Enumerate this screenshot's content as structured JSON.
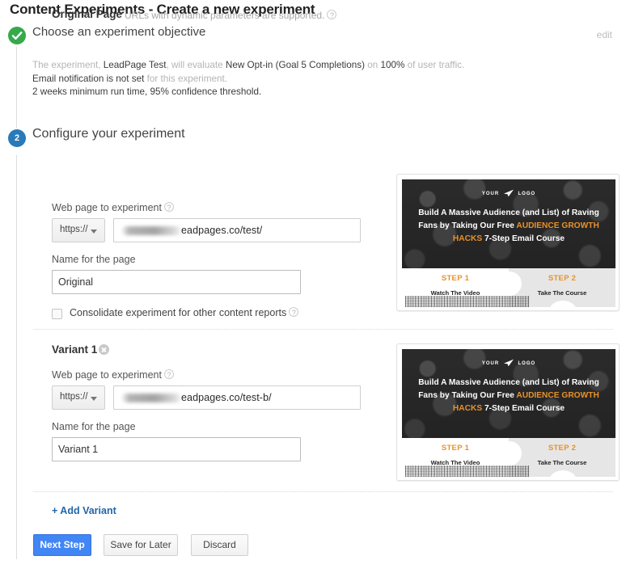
{
  "page": {
    "title": "Content Experiments - Create a new experiment"
  },
  "step1": {
    "badge_icon": "check-circle-icon",
    "title": "Choose an experiment objective",
    "edit_label": "edit",
    "summary": {
      "line1_a": "The experiment, ",
      "line1_b": "LeadPage Test",
      "line1_c": ", will evaluate ",
      "line1_d": "New Opt-in (Goal 5 Completions)",
      "line1_e": " on ",
      "line1_f": "100%",
      "line1_g": " of user traffic.",
      "line2_a": "Email notification is not set",
      "line2_b": " for this experiment.",
      "line3": "2 weeks minimum run time, 95% confidence threshold."
    }
  },
  "step2": {
    "badge_number": "2",
    "title": "Configure your experiment"
  },
  "original": {
    "section_title": "Original Page",
    "section_subtitle": "URLs with dynamic parameters are supported.",
    "help_glyph": "?",
    "web_page_label": "Web page to experiment",
    "protocol_value": "https://",
    "url_value": "eadpages.co/test/",
    "name_label": "Name for the page",
    "name_value": "Original",
    "consolidate_label": "Consolidate experiment for other content reports",
    "consolidate_checked": false
  },
  "variant": {
    "heading": "Variant 1",
    "remove_icon": "remove-circle-icon",
    "web_page_label": "Web page to experiment",
    "protocol_value": "https://",
    "url_value": "eadpages.co/test-b/",
    "name_label": "Name for the page",
    "name_value": "Variant 1"
  },
  "actions": {
    "add_variant": "+ Add Variant",
    "next_step": "Next Step",
    "save_for_later": "Save for Later",
    "discard": "Discard"
  },
  "preview": {
    "logo_text_left": "YOUR",
    "logo_text_right": "LOGO",
    "headline_a": "Build A Massive Audience (and List) of Raving Fans by Taking Our Free ",
    "headline_hl": "AUDIENCE GROWTH HACKS",
    "headline_b": " 7-Step Email Course",
    "step1_title": "STEP 1",
    "step1_sub": "Watch The Video",
    "step2_title": "STEP 2",
    "step2_sub": "Take The Course"
  },
  "colors": {
    "accent_blue": "#4285f4",
    "success_green": "#36a94b",
    "step_badge_blue": "#2a7ab9",
    "link_blue": "#2266aa",
    "preview_orange": "#e8912a"
  }
}
